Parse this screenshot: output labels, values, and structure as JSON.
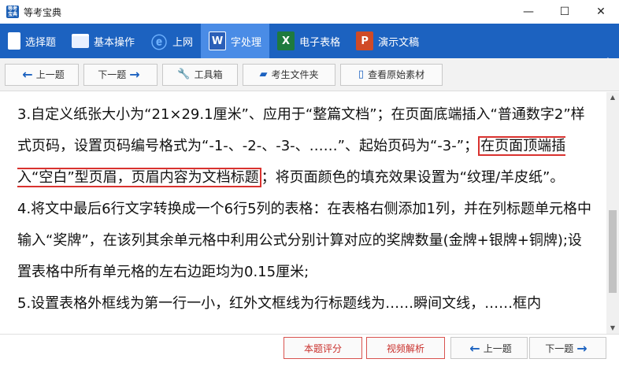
{
  "window": {
    "title": "等考宝典",
    "icon_text": "等考宝典",
    "controls": [
      "—",
      "☐",
      "✕"
    ]
  },
  "nav": {
    "items": [
      {
        "label": "选择题",
        "icon": "select-icon"
      },
      {
        "label": "基本操作",
        "icon": "window-icon"
      },
      {
        "label": "上网",
        "icon": "internet-icon"
      },
      {
        "label": "字处理",
        "icon": "word-icon",
        "icon_text": "W"
      },
      {
        "label": "电子表格",
        "icon": "excel-icon",
        "icon_text": "X"
      },
      {
        "label": "演示文稿",
        "icon": "ppt-icon",
        "icon_text": "P"
      }
    ],
    "active": "字处理",
    "pin": "⊣"
  },
  "toolbar": {
    "prev": "上一题",
    "next": "下一题",
    "tools": "工具箱",
    "student_folder": "考生文件夹",
    "view_source": "查看原始素材"
  },
  "content": {
    "p1_a": "3.自定义纸张大小为“21×29.1厘米”、应用于“整篇文档”；在页面底端插入“普通数字2”样式页码，设置页码编号格式为“-1-、-2-、-3-、……”、起始页码为“-3-”；",
    "p1_highlight": "在页面顶端插入“空白”型页眉，页眉内容为文档标题",
    "p1_b": "；将页面颜色的填充效果设置为“纹理/羊皮纸”。",
    "p2": "4.将文中最后6行文字转换成一个6行5列的表格：在表格右侧添加1列，并在列标题单元格中输入“奖牌”，在该列其余单元格中利用公式分别计算对应的奖牌数量(金牌+银牌+铜牌);设置表格中所有单元格的左右边距均为0.15厘米;",
    "p3": "5.设置表格外框线为第一行一小，红外文框线为行标题线为……瞬间文线，……框内"
  },
  "bottom": {
    "score": "本题评分",
    "video": "视频解析",
    "prev": "上一题",
    "next": "下一题"
  },
  "colors": {
    "nav_bg": "#1c62c0",
    "nav_active": "#4a8ce6",
    "highlight_border": "#d9322f"
  }
}
